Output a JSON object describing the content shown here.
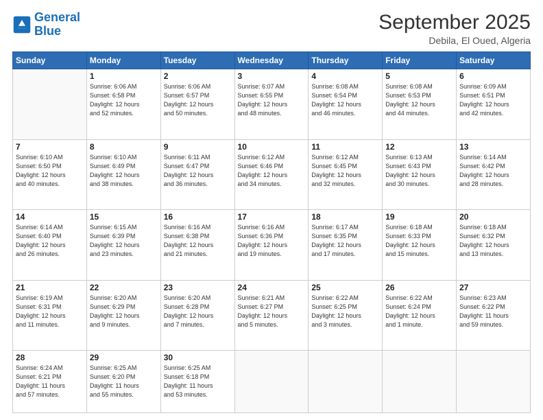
{
  "logo": {
    "line1": "General",
    "line2": "Blue"
  },
  "title": "September 2025",
  "subtitle": "Debila, El Oued, Algeria",
  "days_header": [
    "Sunday",
    "Monday",
    "Tuesday",
    "Wednesday",
    "Thursday",
    "Friday",
    "Saturday"
  ],
  "weeks": [
    [
      {
        "num": "",
        "empty": true
      },
      {
        "num": "1",
        "sunrise": "6:06 AM",
        "sunset": "6:58 PM",
        "daylight": "12 hours and 52 minutes."
      },
      {
        "num": "2",
        "sunrise": "6:06 AM",
        "sunset": "6:57 PM",
        "daylight": "12 hours and 50 minutes."
      },
      {
        "num": "3",
        "sunrise": "6:07 AM",
        "sunset": "6:55 PM",
        "daylight": "12 hours and 48 minutes."
      },
      {
        "num": "4",
        "sunrise": "6:08 AM",
        "sunset": "6:54 PM",
        "daylight": "12 hours and 46 minutes."
      },
      {
        "num": "5",
        "sunrise": "6:08 AM",
        "sunset": "6:53 PM",
        "daylight": "12 hours and 44 minutes."
      },
      {
        "num": "6",
        "sunrise": "6:09 AM",
        "sunset": "6:51 PM",
        "daylight": "12 hours and 42 minutes."
      }
    ],
    [
      {
        "num": "7",
        "sunrise": "6:10 AM",
        "sunset": "6:50 PM",
        "daylight": "12 hours and 40 minutes."
      },
      {
        "num": "8",
        "sunrise": "6:10 AM",
        "sunset": "6:49 PM",
        "daylight": "12 hours and 38 minutes."
      },
      {
        "num": "9",
        "sunrise": "6:11 AM",
        "sunset": "6:47 PM",
        "daylight": "12 hours and 36 minutes."
      },
      {
        "num": "10",
        "sunrise": "6:12 AM",
        "sunset": "6:46 PM",
        "daylight": "12 hours and 34 minutes."
      },
      {
        "num": "11",
        "sunrise": "6:12 AM",
        "sunset": "6:45 PM",
        "daylight": "12 hours and 32 minutes."
      },
      {
        "num": "12",
        "sunrise": "6:13 AM",
        "sunset": "6:43 PM",
        "daylight": "12 hours and 30 minutes."
      },
      {
        "num": "13",
        "sunrise": "6:14 AM",
        "sunset": "6:42 PM",
        "daylight": "12 hours and 28 minutes."
      }
    ],
    [
      {
        "num": "14",
        "sunrise": "6:14 AM",
        "sunset": "6:40 PM",
        "daylight": "12 hours and 26 minutes."
      },
      {
        "num": "15",
        "sunrise": "6:15 AM",
        "sunset": "6:39 PM",
        "daylight": "12 hours and 23 minutes."
      },
      {
        "num": "16",
        "sunrise": "6:16 AM",
        "sunset": "6:38 PM",
        "daylight": "12 hours and 21 minutes."
      },
      {
        "num": "17",
        "sunrise": "6:16 AM",
        "sunset": "6:36 PM",
        "daylight": "12 hours and 19 minutes."
      },
      {
        "num": "18",
        "sunrise": "6:17 AM",
        "sunset": "6:35 PM",
        "daylight": "12 hours and 17 minutes."
      },
      {
        "num": "19",
        "sunrise": "6:18 AM",
        "sunset": "6:33 PM",
        "daylight": "12 hours and 15 minutes."
      },
      {
        "num": "20",
        "sunrise": "6:18 AM",
        "sunset": "6:32 PM",
        "daylight": "12 hours and 13 minutes."
      }
    ],
    [
      {
        "num": "21",
        "sunrise": "6:19 AM",
        "sunset": "6:31 PM",
        "daylight": "12 hours and 11 minutes."
      },
      {
        "num": "22",
        "sunrise": "6:20 AM",
        "sunset": "6:29 PM",
        "daylight": "12 hours and 9 minutes."
      },
      {
        "num": "23",
        "sunrise": "6:20 AM",
        "sunset": "6:28 PM",
        "daylight": "12 hours and 7 minutes."
      },
      {
        "num": "24",
        "sunrise": "6:21 AM",
        "sunset": "6:27 PM",
        "daylight": "12 hours and 5 minutes."
      },
      {
        "num": "25",
        "sunrise": "6:22 AM",
        "sunset": "6:25 PM",
        "daylight": "12 hours and 3 minutes."
      },
      {
        "num": "26",
        "sunrise": "6:22 AM",
        "sunset": "6:24 PM",
        "daylight": "12 hours and 1 minute."
      },
      {
        "num": "27",
        "sunrise": "6:23 AM",
        "sunset": "6:22 PM",
        "daylight": "11 hours and 59 minutes."
      }
    ],
    [
      {
        "num": "28",
        "sunrise": "6:24 AM",
        "sunset": "6:21 PM",
        "daylight": "11 hours and 57 minutes."
      },
      {
        "num": "29",
        "sunrise": "6:25 AM",
        "sunset": "6:20 PM",
        "daylight": "11 hours and 55 minutes."
      },
      {
        "num": "30",
        "sunrise": "6:25 AM",
        "sunset": "6:18 PM",
        "daylight": "11 hours and 53 minutes."
      },
      {
        "num": "",
        "empty": true
      },
      {
        "num": "",
        "empty": true
      },
      {
        "num": "",
        "empty": true
      },
      {
        "num": "",
        "empty": true
      }
    ]
  ]
}
